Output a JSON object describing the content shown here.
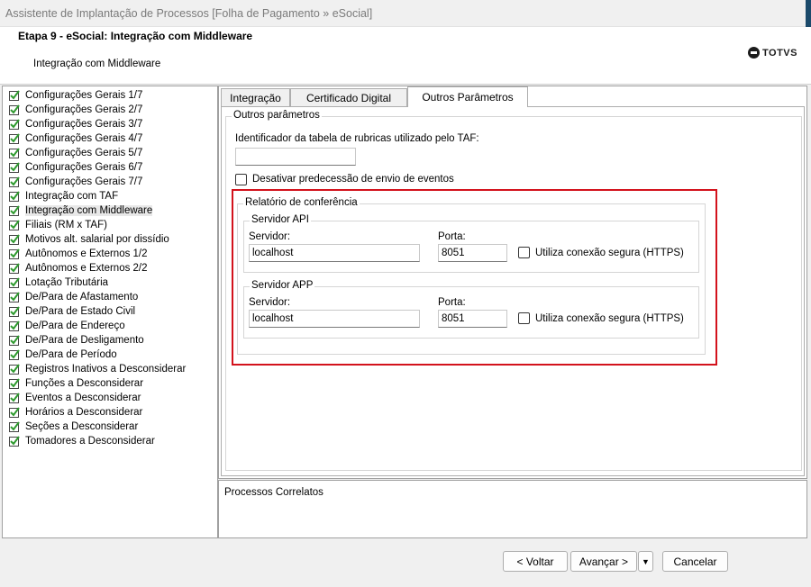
{
  "window": {
    "title": "Assistente de Implantação de Processos [Folha de Pagamento » eSocial]"
  },
  "header": {
    "step_title": "Etapa 9 - eSocial: Integração com Middleware",
    "step_subtitle": "Integração com Middleware",
    "logo_text": "TOTVS"
  },
  "steps": [
    {
      "label": "Configurações Gerais 1/7"
    },
    {
      "label": "Configurações Gerais 2/7"
    },
    {
      "label": "Configurações Gerais 3/7"
    },
    {
      "label": "Configurações Gerais 4/7"
    },
    {
      "label": "Configurações Gerais 5/7"
    },
    {
      "label": "Configurações Gerais 6/7"
    },
    {
      "label": "Configurações Gerais 7/7"
    },
    {
      "label": "Integração com TAF"
    },
    {
      "label": "Integração com Middleware"
    },
    {
      "label": "Filiais (RM x TAF)"
    },
    {
      "label": "Motivos alt. salarial por dissídio"
    },
    {
      "label": "Autônomos e Externos 1/2"
    },
    {
      "label": "Autônomos e Externos 2/2"
    },
    {
      "label": "Lotação Tributária"
    },
    {
      "label": "De/Para de Afastamento"
    },
    {
      "label": "De/Para de Estado Civil"
    },
    {
      "label": "De/Para de Endereço"
    },
    {
      "label": "De/Para de Desligamento"
    },
    {
      "label": "De/Para de Período"
    },
    {
      "label": "Registros Inativos a Desconsiderar"
    },
    {
      "label": "Funções a Desconsiderar"
    },
    {
      "label": "Eventos a Desconsiderar"
    },
    {
      "label": "Horários a Desconsiderar"
    },
    {
      "label": "Seções a Desconsiderar"
    },
    {
      "label": "Tomadores a Desconsiderar"
    }
  ],
  "tabs": [
    {
      "label": "Integração"
    },
    {
      "label": "Certificado Digital"
    },
    {
      "label": "Outros Parâmetros"
    }
  ],
  "other_params": {
    "group_title": "Outros parâmetros",
    "rubric_table_label": "Identificador da tabela de rubricas utilizado pelo TAF:",
    "rubric_table_value": "",
    "disable_predecessor_label": "Desativar predecessão de envio de eventos",
    "report": {
      "group_title": "Relatório de conferência",
      "api": {
        "title": "Servidor API",
        "server_label": "Servidor:",
        "server_value": "localhost",
        "port_label": "Porta:",
        "port_value": "8051",
        "https_label": "Utiliza conexão segura (HTTPS)"
      },
      "app": {
        "title": "Servidor APP",
        "server_label": "Servidor:",
        "server_value": "localhost",
        "port_label": "Porta:",
        "port_value": "8051",
        "https_label": "Utiliza conexão segura (HTTPS)"
      }
    }
  },
  "related": {
    "label": "Processos Correlatos"
  },
  "footer": {
    "back": "< Voltar",
    "next": "Avançar >",
    "cancel": "Cancelar"
  },
  "colors": {
    "check_green": "#2e9a2e",
    "highlight_red": "#d3121c"
  }
}
